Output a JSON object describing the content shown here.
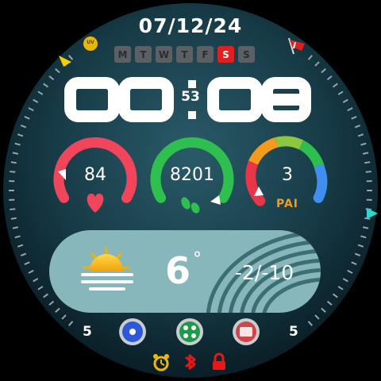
{
  "date": "07/12/24",
  "weekdays": [
    {
      "label": "M",
      "active": false
    },
    {
      "label": "T",
      "active": false
    },
    {
      "label": "W",
      "active": false
    },
    {
      "label": "T",
      "active": false
    },
    {
      "label": "F",
      "active": false
    },
    {
      "label": "S",
      "active": true
    },
    {
      "label": "S",
      "active": false
    }
  ],
  "uv_badge": "UV",
  "time": {
    "hours": "00",
    "minutes": "08",
    "seconds": "53"
  },
  "gauges": {
    "heart_rate": {
      "value": "84",
      "color": "#f0455a",
      "icon": "heart-icon"
    },
    "steps": {
      "value": "8201",
      "color": "#2fbf4f",
      "icon": "footprints-icon"
    },
    "pai": {
      "value": "3",
      "label": "PAI",
      "colors": [
        "#e8354a",
        "#f49b1e",
        "#8dc63f",
        "#2fbf4f",
        "#3f8ef0"
      ]
    }
  },
  "weather": {
    "temperature": "6",
    "degree": "°",
    "range": "-2/-10",
    "icon": "partly-sunny-icon"
  },
  "bottom": {
    "left_value": "5",
    "right_value": "5"
  },
  "status_icons": [
    "alarm-icon",
    "bluetooth-icon",
    "lock-icon"
  ],
  "colors": {
    "background": "#0f2a33",
    "accent": "#3ee8e0",
    "active_day": "#e02020"
  }
}
